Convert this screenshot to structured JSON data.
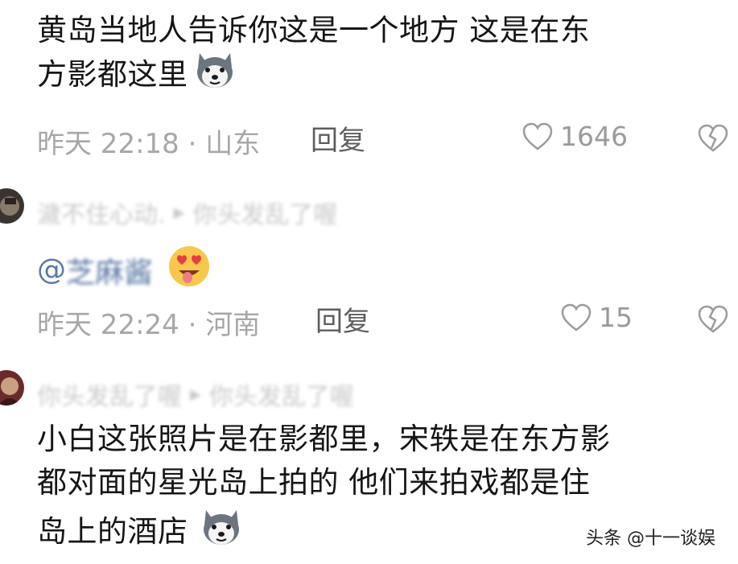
{
  "comments": [
    {
      "text_line1": "黄岛当地人告诉你这是一个地方  这是在东",
      "text_line2": "方影都这里",
      "time": "昨天 22:18 · 山东",
      "reply_label": "回复",
      "likes": "1646"
    },
    {
      "username": "濊不住心动.",
      "reply_to": "你头发乱了喔",
      "mention_at": "@",
      "mention_name": "芝麻酱",
      "time": "昨天 22:24 · 河南",
      "reply_label": "回复",
      "likes": "15"
    },
    {
      "username": "你头发乱了喔",
      "reply_to": "你头发乱了喔",
      "text_line1": "小白这张照片是在影都里，宋轶是在东方影",
      "text_line2": "都对面的星光岛上拍的 他们来拍戏都是住",
      "text_line3": "岛上的酒店"
    }
  ],
  "watermark": "头条 @十一谈娱",
  "colors": {
    "text": "#161616",
    "meta": "#a7a7a7",
    "reply": "#5d5d5d",
    "mention": "#5b7aa6",
    "icon": "#9b9b9b"
  },
  "icons": [
    "husky-emoji",
    "heart-eyes-emoji",
    "heart-icon",
    "broken-heart-icon",
    "triangle-arrow-icon"
  ]
}
